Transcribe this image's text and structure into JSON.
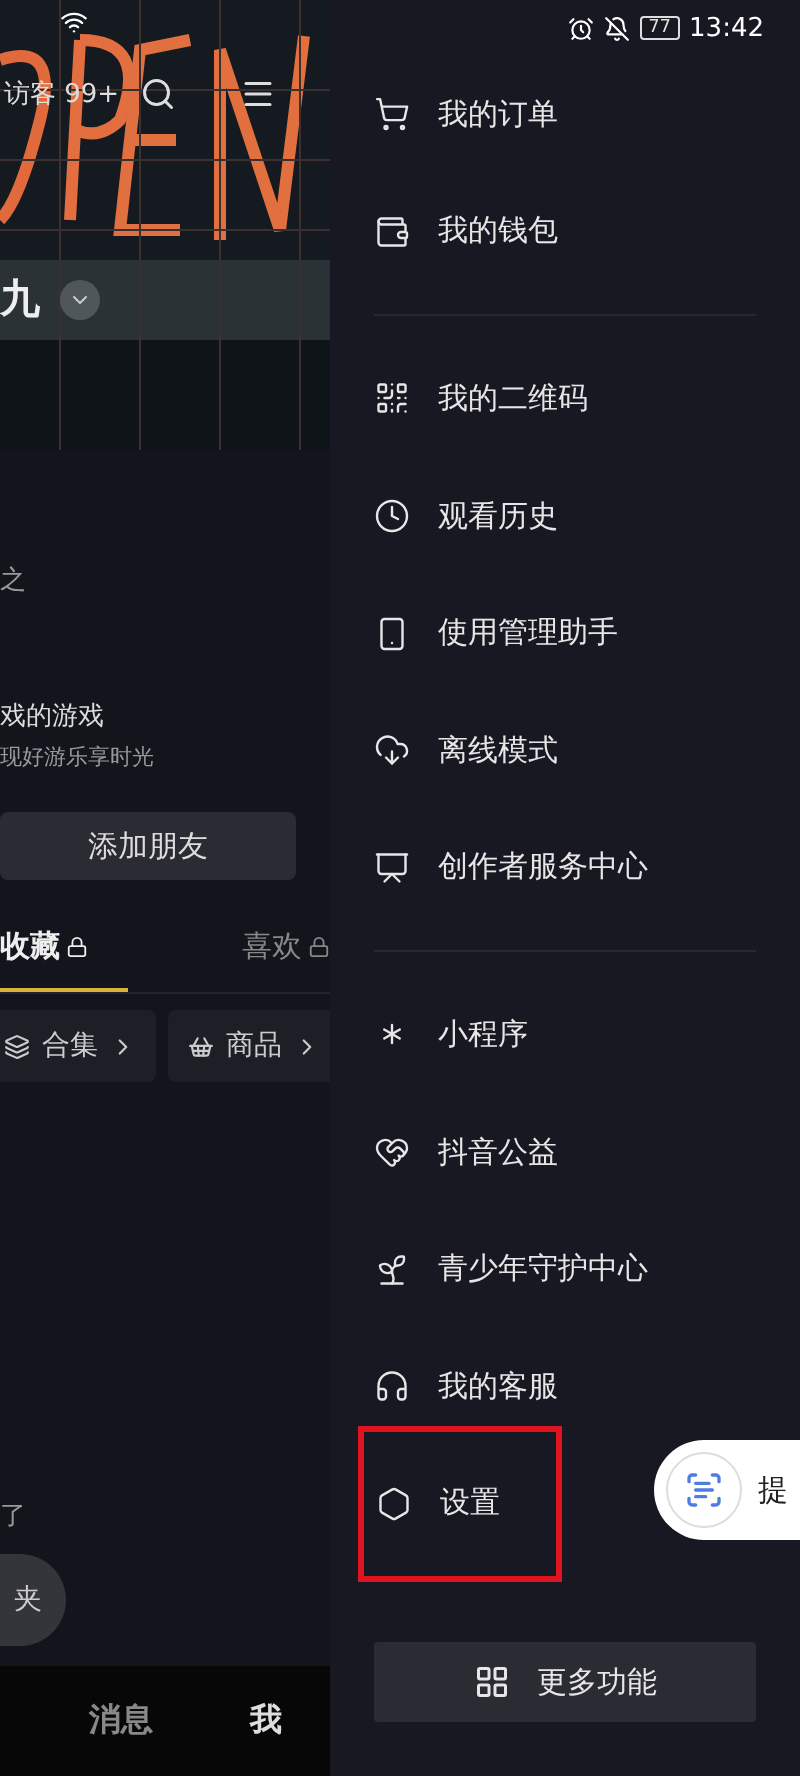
{
  "profile": {
    "visitors": "访客 99+",
    "name": "九",
    "bio": "之",
    "game_title": "戏的游戏",
    "game_subtitle": "现好游乐享时光",
    "add_friend": "添加朋友",
    "tabs": [
      {
        "label": "收藏",
        "locked": true,
        "selected": true
      },
      {
        "label": "喜欢",
        "locked": true,
        "selected": false
      }
    ],
    "chips": [
      {
        "label": "合集",
        "kind": "collection"
      },
      {
        "label": "商品",
        "kind": "shop"
      }
    ],
    "empty_text": "了",
    "empty_button": "夹"
  },
  "bottom_nav": [
    {
      "label": "消息",
      "selected": false
    },
    {
      "label": "我",
      "selected": true
    }
  ],
  "status_bar": {
    "battery": "77",
    "time": "13:42"
  },
  "drawer": {
    "sections": [
      [
        {
          "kind": "cart",
          "label": "我的订单",
          "highlighted": false
        },
        {
          "kind": "wallet",
          "label": "我的钱包",
          "highlighted": false
        }
      ],
      [
        {
          "kind": "qr",
          "label": "我的二维码",
          "highlighted": false
        },
        {
          "kind": "clock",
          "label": "观看历史",
          "highlighted": false
        },
        {
          "kind": "phone",
          "label": "使用管理助手",
          "highlighted": false
        },
        {
          "kind": "cloud",
          "label": "离线模式",
          "highlighted": false
        },
        {
          "kind": "monitor",
          "label": "创作者服务中心",
          "highlighted": false
        }
      ],
      [
        {
          "kind": "spark",
          "label": "小程序",
          "highlighted": false
        },
        {
          "kind": "heart",
          "label": "抖音公益",
          "highlighted": false
        },
        {
          "kind": "sprout",
          "label": "青少年守护中心",
          "highlighted": false
        },
        {
          "kind": "headset",
          "label": "我的客服",
          "highlighted": false
        },
        {
          "kind": "hexagon",
          "label": "设置",
          "highlighted": true
        }
      ]
    ],
    "more_button": "更多功能"
  },
  "floating_tool": {
    "label": "提"
  }
}
